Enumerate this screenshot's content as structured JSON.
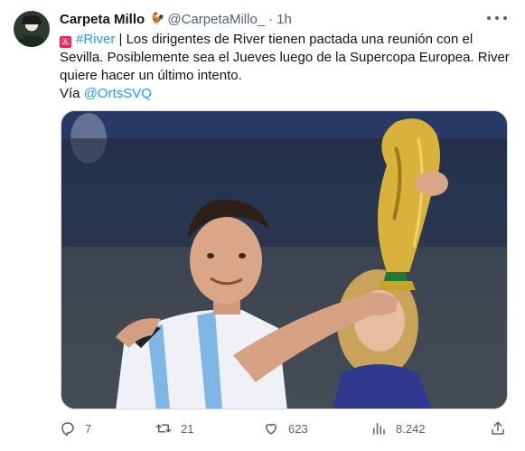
{
  "tweet": {
    "display_name": "Carpeta Millo",
    "name_emoji": "🐓",
    "handle": "@CarpetaMillo_",
    "separator": "·",
    "time": "1h",
    "flag_emoji": "🇦",
    "hashtag": "#River",
    "text_line1_rest": " | Los dirigentes de River tienen pactada una reunión con el",
    "text_line2": "Sevilla. Posiblemente sea el Jueves luego de la Supercopa Europea. River",
    "text_line3": "quiere hacer un último intento.",
    "via_label": "Vía ",
    "via_mention": "@OrtsSVQ"
  },
  "actions": {
    "reply_count": "7",
    "retweet_count": "21",
    "like_count": "623",
    "views_count": "8.242"
  },
  "icons": {
    "avatar": "avatar-image",
    "more": "more-icon",
    "reply": "reply-icon",
    "retweet": "retweet-icon",
    "like": "heart-icon",
    "views": "analytics-icon",
    "share": "share-icon"
  },
  "colors": {
    "link": "#1d9bf0",
    "text": "#0f1419",
    "secondary": "#536471",
    "flag_red": "#e0245e"
  }
}
